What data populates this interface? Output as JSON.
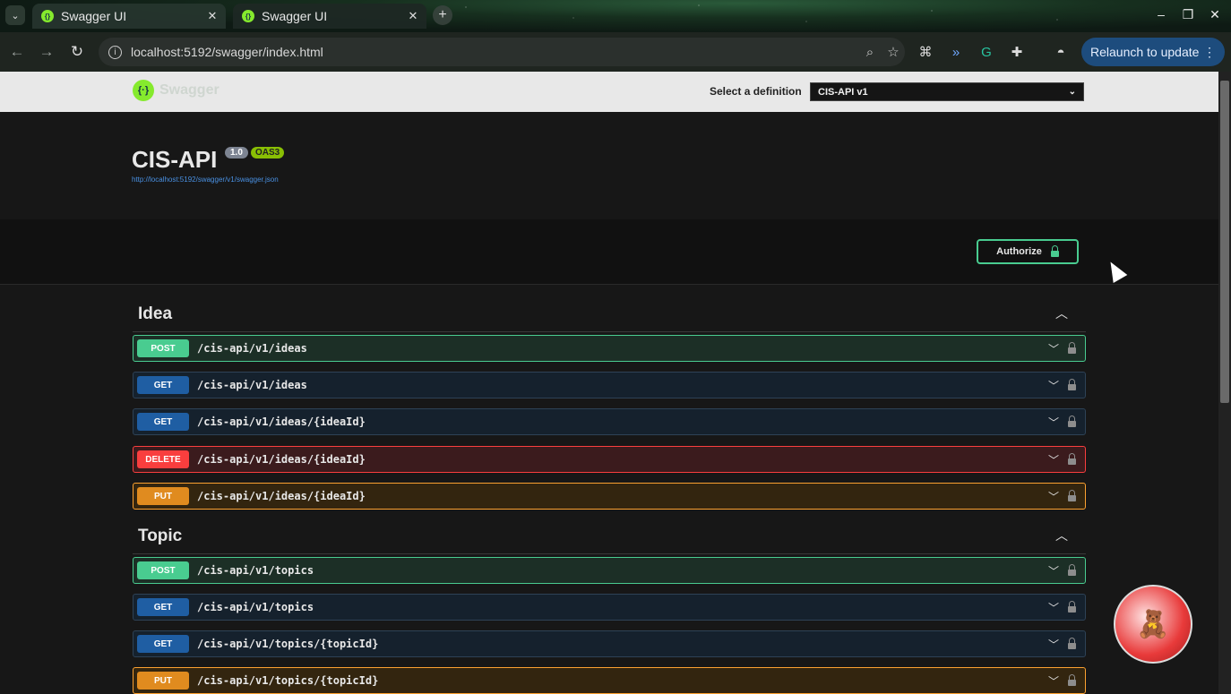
{
  "browser": {
    "tabs": [
      {
        "title": "Swagger UI",
        "active": false
      },
      {
        "title": "Swagger UI",
        "active": true
      }
    ],
    "new_tab": "+",
    "url": "localhost:5192/swagger/index.html",
    "relaunch_label": "Relaunch to update",
    "window_controls": {
      "minimize": "–",
      "restore": "❐",
      "close": "✕"
    }
  },
  "topbar": {
    "brand": "Swagger",
    "definition_label": "Select a definition",
    "definition_selected": "CIS-API v1"
  },
  "info": {
    "title": "CIS-API",
    "version": "1.0",
    "oas_badge": "OAS3",
    "spec_url": "http://localhost:5192/swagger/v1/swagger.json"
  },
  "authorize_label": "Authorize",
  "tags": [
    {
      "name": "Idea",
      "operations": [
        {
          "method": "POST",
          "path": "/cis-api/v1/ideas"
        },
        {
          "method": "GET",
          "path": "/cis-api/v1/ideas"
        },
        {
          "method": "GET",
          "path": "/cis-api/v1/ideas/{ideaId}"
        },
        {
          "method": "DELETE",
          "path": "/cis-api/v1/ideas/{ideaId}"
        },
        {
          "method": "PUT",
          "path": "/cis-api/v1/ideas/{ideaId}"
        }
      ]
    },
    {
      "name": "Topic",
      "operations": [
        {
          "method": "POST",
          "path": "/cis-api/v1/topics"
        },
        {
          "method": "GET",
          "path": "/cis-api/v1/topics"
        },
        {
          "method": "GET",
          "path": "/cis-api/v1/topics/{topicId}"
        },
        {
          "method": "PUT",
          "path": "/cis-api/v1/topics/{topicId}"
        }
      ]
    }
  ],
  "colors": {
    "post": "#49cc90",
    "get": "#1f5ea3",
    "delete": "#f93e3e",
    "put": "#fca130",
    "swagger_green": "#85ea2d",
    "relaunch_bg": "#1d4c7d"
  }
}
